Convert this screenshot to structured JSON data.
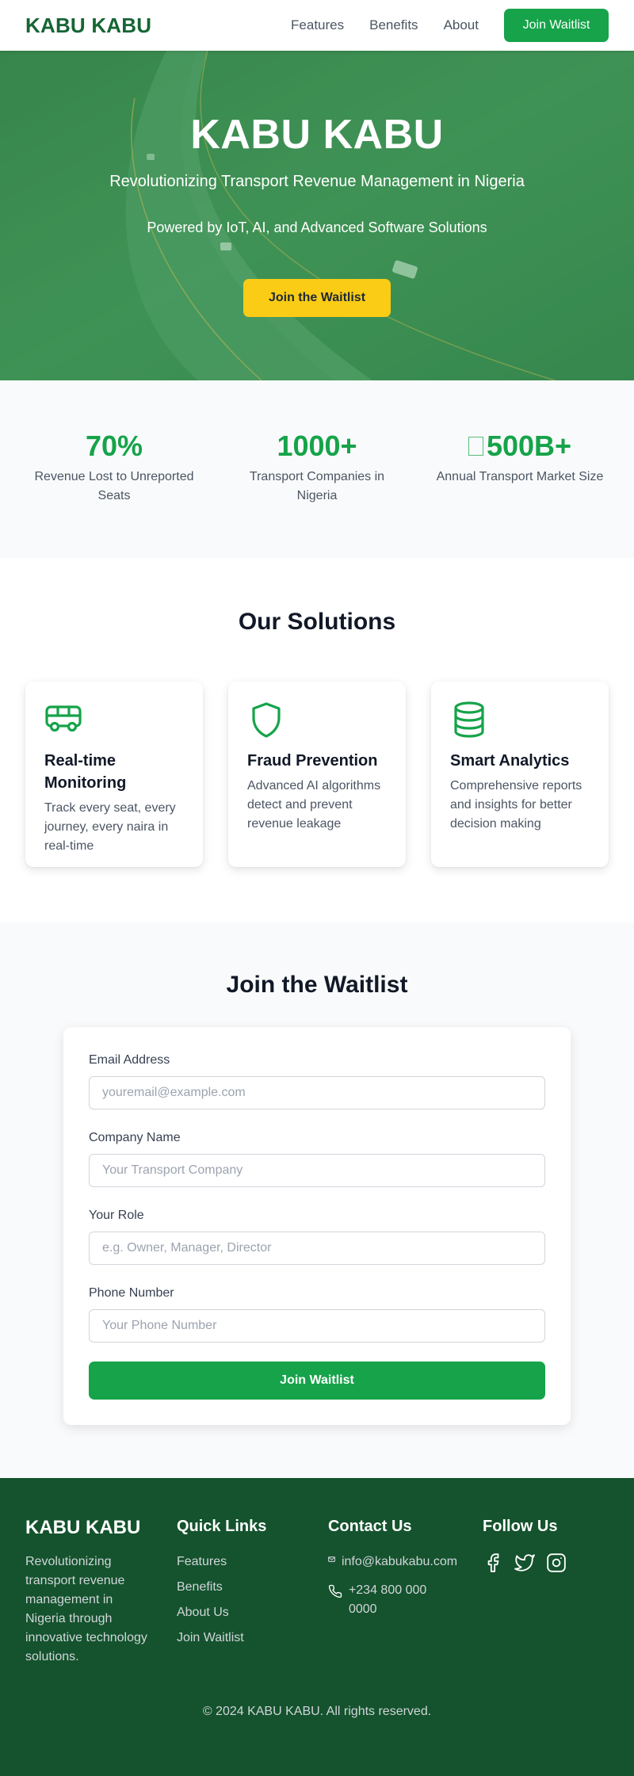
{
  "nav": {
    "logo": "KABU KABU",
    "links": [
      "Features",
      "Benefits",
      "About"
    ],
    "cta": "Join Waitlist"
  },
  "hero": {
    "title": "KABU KABU",
    "subtitle": "Revolutionizing Transport Revenue Management in Nigeria",
    "tagline": "Powered by IoT, AI, and Advanced Software Solutions",
    "cta": "Join the Waitlist"
  },
  "stats": [
    {
      "value": "70%",
      "label": "Revenue Lost to Unreported Seats"
    },
    {
      "value": "1000+",
      "label": "Transport Companies in Nigeria"
    },
    {
      "value": "500B+",
      "label": "Annual Transport Market Size"
    }
  ],
  "solutions": {
    "title": "Our Solutions",
    "cards": [
      {
        "icon": "bus-icon",
        "title": "Real-time Monitoring",
        "description": "Track every seat, every journey, every naira in real-time"
      },
      {
        "icon": "shield-icon",
        "title": "Fraud Prevention",
        "description": "Advanced AI algorithms detect and prevent revenue leakage"
      },
      {
        "icon": "database-icon",
        "title": "Smart Analytics",
        "description": "Comprehensive reports and insights for better decision making"
      }
    ]
  },
  "waitlist": {
    "title": "Join the Waitlist",
    "fields": [
      {
        "label": "Email Address",
        "placeholder": "youremail@example.com"
      },
      {
        "label": "Company Name",
        "placeholder": "Your Transport Company"
      },
      {
        "label": "Your Role",
        "placeholder": "e.g. Owner, Manager, Director"
      },
      {
        "label": "Phone Number",
        "placeholder": "Your Phone Number"
      }
    ],
    "submit": "Join Waitlist"
  },
  "footer": {
    "logo": "KABU KABU",
    "about": "Revolutionizing transport revenue management in Nigeria through innovative technology solutions.",
    "quick_links": {
      "heading": "Quick Links",
      "items": [
        "Features",
        "Benefits",
        "About Us",
        "Join Waitlist"
      ]
    },
    "contact": {
      "heading": "Contact Us",
      "email": "info@kabukabu.com",
      "phone": "+234 800 000 0000"
    },
    "follow": {
      "heading": "Follow Us",
      "icons": [
        "facebook-icon",
        "twitter-icon",
        "instagram-icon"
      ]
    },
    "copyright": "© 2024 KABU KABU. All rights reserved."
  },
  "colors": {
    "brand_green": "#16a34a",
    "dark_green": "#14532d",
    "accent_yellow": "#facc15"
  }
}
